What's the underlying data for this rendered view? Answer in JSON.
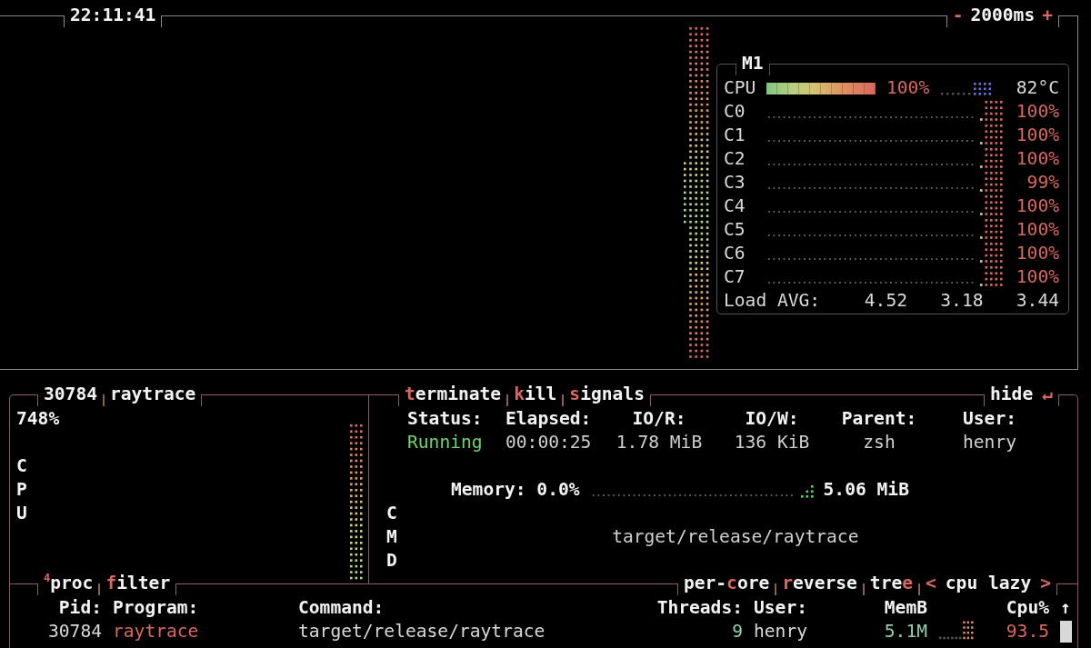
{
  "header": {
    "clock": "22:11:41",
    "interval": {
      "minus": "-",
      "value": "2000ms",
      "plus": "+"
    }
  },
  "cpu_panel": {
    "model": "M1",
    "total": {
      "label": "CPU",
      "level": 1.0,
      "reading": "100%",
      "temperature": "82°C"
    },
    "cores": [
      {
        "label": "C0",
        "reading": "100%"
      },
      {
        "label": "C1",
        "reading": "100%"
      },
      {
        "label": "C2",
        "reading": "100%"
      },
      {
        "label": "C3",
        "reading": "99%"
      },
      {
        "label": "C4",
        "reading": "100%"
      },
      {
        "label": "C5",
        "reading": "100%"
      },
      {
        "label": "C6",
        "reading": "100%"
      },
      {
        "label": "C7",
        "reading": "100%"
      }
    ],
    "load_avg": {
      "label": "Load AVG:",
      "values": [
        "4.52",
        "3.18",
        "3.44"
      ]
    }
  },
  "detail": {
    "pid": "30784",
    "name": "raytrace",
    "cpu_reading": "748%",
    "cpu_axis": "CPU",
    "actions": [
      {
        "key": "t",
        "rest": "erminate"
      },
      {
        "key": "k",
        "rest": "ill"
      },
      {
        "key": "s",
        "rest": "ignals"
      }
    ],
    "hide": {
      "label": "hide",
      "icon": "↵"
    },
    "fields": [
      {
        "label": "Status:",
        "value": "Running",
        "kind": "status"
      },
      {
        "label": "Elapsed:",
        "value": "00:00:25",
        "kind": "text"
      },
      {
        "label": "IO/R:",
        "value": "1.78 MiB",
        "kind": "text"
      },
      {
        "label": "IO/W:",
        "value": "136 KiB",
        "kind": "text"
      },
      {
        "label": "Parent:",
        "value": "zsh",
        "kind": "text"
      },
      {
        "label": "User:",
        "value": "henry",
        "kind": "text"
      }
    ],
    "memory": {
      "label": "Memory: 0.0%",
      "reading": "5.06 MiB"
    },
    "cmd_axis": "CMD",
    "command": "target/release/raytrace"
  },
  "processes": {
    "badge": "4",
    "title": "proc",
    "filter": {
      "key": "f",
      "rest": "ilter"
    },
    "options": [
      {
        "before": "per-",
        "key": "c",
        "after": "ore"
      },
      {
        "key": "r",
        "after": "everse"
      },
      {
        "before": "tre",
        "key": "e"
      }
    ],
    "sort": {
      "prev": "<",
      "label": "cpu lazy",
      "next": ">"
    },
    "columns": [
      "Pid:",
      "Program:",
      "Command:",
      "Threads:",
      "User:",
      "MemB",
      "Cpu%"
    ],
    "sort_indicator": "↑",
    "rows": [
      {
        "pid": "30784",
        "program": "raytrace",
        "command": "target/release/raytrace",
        "threads": "9",
        "user": "henry",
        "mem": "5.1M",
        "cpu": "93.5"
      }
    ]
  }
}
